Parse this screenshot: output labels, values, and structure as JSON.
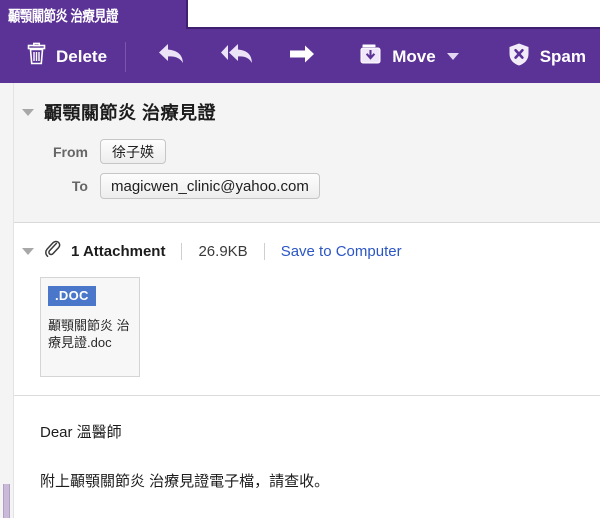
{
  "tab": {
    "title": "顳顎關節炎 治療見證"
  },
  "toolbar": {
    "delete_label": "Delete",
    "reply_icon": "reply-arrow-icon",
    "reply_all_icon": "reply-all-arrow-icon",
    "forward_icon": "forward-arrow-icon",
    "move_label": "Move",
    "spam_label": "Spam",
    "trash_icon": "trash-icon",
    "move_icon": "folder-move-icon",
    "spam_icon": "shield-x-icon",
    "caret_icon": "chevron-down-icon",
    "accent_purple": "#5b3296"
  },
  "mail": {
    "subject": "顳顎關節炎 治療見證",
    "collapse_icon": "twisty-down-icon",
    "from_label": "From",
    "from_value": "徐子媖",
    "to_label": "To",
    "to_value": "magicwen_clinic@yahoo.com"
  },
  "attachments": {
    "collapse_icon": "twisty-down-icon",
    "paperclip_icon": "paperclip-icon",
    "count_label": "1 Attachment",
    "size_label": "26.9KB",
    "save_label": "Save to Computer",
    "save_link_color": "#2b56c4",
    "items": [
      {
        "type_badge": ".DOC",
        "badge_color": "#4a77c9",
        "filename": "顳顎關節炎 治療見證.doc"
      }
    ]
  },
  "body": {
    "greeting": "Dear 溫醫師",
    "paragraph": "附上顳顎關節炎 治療見證電子檔，請查收。"
  }
}
